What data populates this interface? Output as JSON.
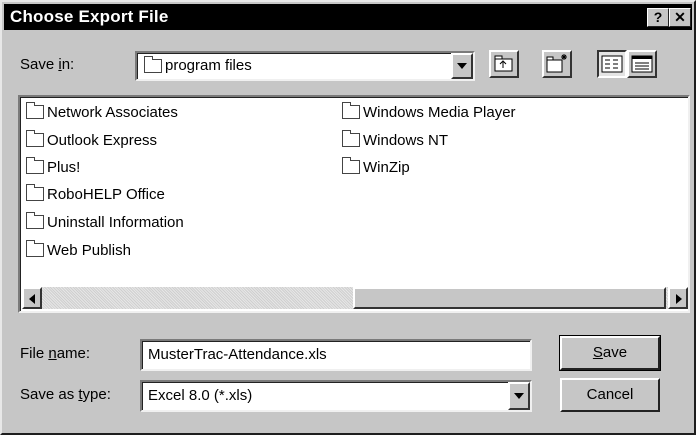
{
  "window": {
    "title": "Choose Export File",
    "help_label": "?",
    "close_label": "✕"
  },
  "save_in": {
    "label_pre": "Save ",
    "label_ul": "i",
    "label_post": "n:",
    "value": "program files"
  },
  "toolbar": {
    "up_icon": "folder-up-icon",
    "new_folder_icon": "new-folder-icon",
    "list_view_icon": "list-view-icon",
    "details_view_icon": "details-view-icon"
  },
  "files": {
    "col1": [
      "Network Associates",
      "Outlook Express",
      "Plus!",
      "RoboHELP Office",
      "Uninstall Information",
      "Web Publish"
    ],
    "col2": [
      "Windows Media Player",
      "Windows NT",
      "WinZip"
    ]
  },
  "file_name": {
    "label_pre": "File ",
    "label_ul": "n",
    "label_post": "ame:",
    "value": "MusterTrac-Attendance.xls"
  },
  "save_type": {
    "label_pre": "Save as ",
    "label_ul": "t",
    "label_post": "ype:",
    "value": "Excel 8.0 (*.xls)"
  },
  "buttons": {
    "save_ul": "S",
    "save_rest": "ave",
    "cancel": "Cancel"
  }
}
